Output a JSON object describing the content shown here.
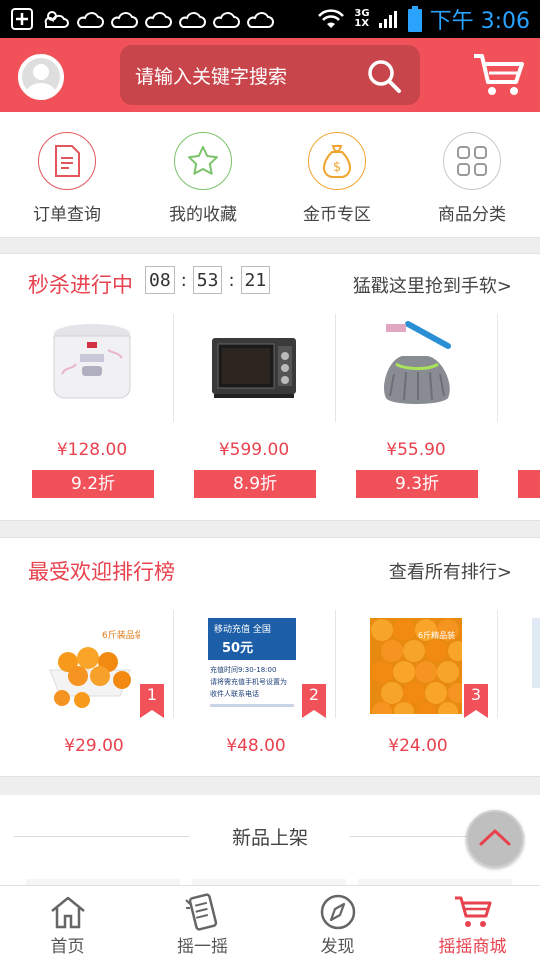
{
  "status_bar": {
    "time": "下午 3:06",
    "network_label": "3G",
    "network_label2": "1X"
  },
  "header": {
    "search_placeholder": "请输入关键字搜索",
    "brand_color": "#f15159"
  },
  "quick_entries": [
    {
      "label": "订单查询",
      "icon": "order-icon",
      "color": "#e0585e"
    },
    {
      "label": "我的收藏",
      "icon": "star-icon",
      "color": "#7bc26b"
    },
    {
      "label": "金币专区",
      "icon": "coin-icon",
      "color": "#f0a531"
    },
    {
      "label": "商品分类",
      "icon": "grid-icon",
      "color": "#9a9a9a"
    }
  ],
  "flash_sale": {
    "title": "秒杀进行中",
    "timer": {
      "h": "08",
      "m": "53",
      "s": "21"
    },
    "link": "猛戳这里抢到手软>",
    "items": [
      {
        "price": "¥128.00",
        "discount": "9.2折",
        "image": "rice-cooker"
      },
      {
        "price": "¥599.00",
        "discount": "8.9折",
        "image": "oven"
      },
      {
        "price": "¥55.90",
        "discount": "9.3折",
        "image": "mop"
      }
    ]
  },
  "ranking": {
    "title": "最受欢迎排行榜",
    "link": "查看所有排行>",
    "items": [
      {
        "price": "¥29.00",
        "rank": "1",
        "image": "oranges-bowl",
        "caption": "6斤装品袋"
      },
      {
        "price": "¥48.00",
        "rank": "2",
        "image": "recharge-card",
        "card_header": "移动充值 全国",
        "card_amount": "50元",
        "card_line1": "充值时间9:30-18:00",
        "card_line2": "请将需充值手机号设置为",
        "card_line3": "收件人联系电话"
      },
      {
        "price": "¥24.00",
        "rank": "3",
        "image": "oranges-pile",
        "caption": "6斤精品装"
      }
    ]
  },
  "new_arrivals": {
    "title": "新品上架"
  },
  "tabs": [
    {
      "label": "首页",
      "icon": "home-icon",
      "active": false
    },
    {
      "label": "摇一摇",
      "icon": "shake-icon",
      "active": false
    },
    {
      "label": "发现",
      "icon": "compass-icon",
      "active": false
    },
    {
      "label": "摇摇商城",
      "icon": "cart-icon",
      "active": true
    }
  ]
}
